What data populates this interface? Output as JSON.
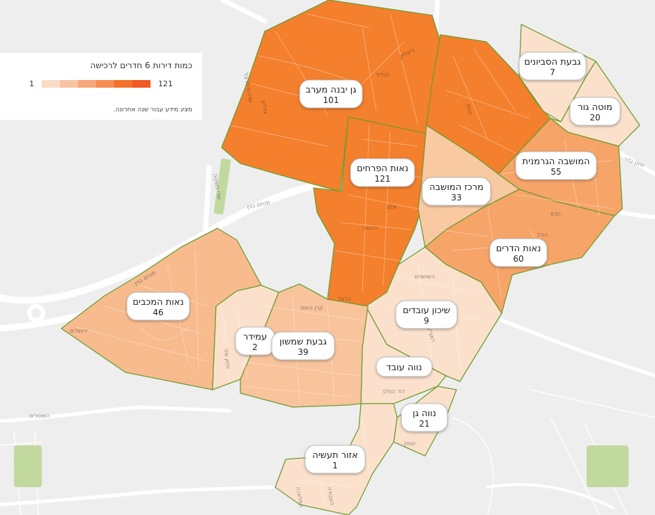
{
  "legend": {
    "title": "כמות דירות 6 חדרים לרכישה",
    "min_label": "1",
    "max_label": "121",
    "note": "מציג מידע עבור שנה אחרונה.",
    "scale_colors": [
      "#fbdcc6",
      "#f9c39f",
      "#f7a878",
      "#f58c51",
      "#f3702a",
      "#f15a22"
    ]
  },
  "neighborhoods": [
    {
      "id": "gan-yavne-west",
      "name": "גן יבנה מערב",
      "count": 101,
      "color": "#f47f2c"
    },
    {
      "id": "neot-haprachim",
      "name": "נאות הפרחים",
      "count": 121,
      "color": "#f47f2c"
    },
    {
      "id": "north-east",
      "name": "",
      "count": null,
      "color": "#f47f2c"
    },
    {
      "id": "givat-hasavyonim",
      "name": "גבעת הסביונים",
      "count": 7,
      "color": "#fbe1cc"
    },
    {
      "id": "motza-gur",
      "name": "מוטה גור",
      "count": 20,
      "color": "#fbe1cc"
    },
    {
      "id": "hamoshava-hagermanit",
      "name": "המושבה הגרמנית",
      "count": 55,
      "color": "#f7a468"
    },
    {
      "id": "merkaz-hamoshava",
      "name": "מרכז המושבה",
      "count": 33,
      "color": "#f9c9a2"
    },
    {
      "id": "neot-hadarim",
      "name": "נאות הדרים",
      "count": 60,
      "color": "#f7a468"
    },
    {
      "id": "shikun-ovdim",
      "name": "שיכון עובדים",
      "count": 9,
      "color": "#fbe1cc"
    },
    {
      "id": "neve-oved",
      "name": "נווה עובד",
      "count": null,
      "color": "#fbe1cc"
    },
    {
      "id": "neot-hamichbim",
      "name": "נאות המכבים",
      "count": 46,
      "color": "#f8bb8e"
    },
    {
      "id": "amidar",
      "name": "עמידר",
      "count": 2,
      "color": "#fbe1cc"
    },
    {
      "id": "givat-shimshon",
      "name": "גבעת שמשון",
      "count": 39,
      "color": "#f9c39c"
    },
    {
      "id": "neve-gan",
      "name": "נווה גן",
      "count": 21,
      "color": "#fbe1cc"
    },
    {
      "id": "ezor-taasiya",
      "name": "אזור תעשיה",
      "count": 1,
      "color": "#fbe1cc"
    }
  ],
  "street_labels": [
    "שדרות הרצל",
    "הגליל",
    "ההגנה",
    "מנחם בגין",
    "מנחם בגין",
    "שדי השיטה",
    "יוחנן בדר",
    "השוטרים",
    "ירושלים",
    "זלמן שזר",
    "דוד המלך",
    "רמב\"ם",
    "יסמין",
    "המלאכה",
    "העבודה",
    "קרן היסוד",
    "אלון",
    "הרצל",
    "גורדון",
    "הגפן",
    "ביאליק",
    "השושנים",
    "הורד",
    "הדס"
  ]
}
